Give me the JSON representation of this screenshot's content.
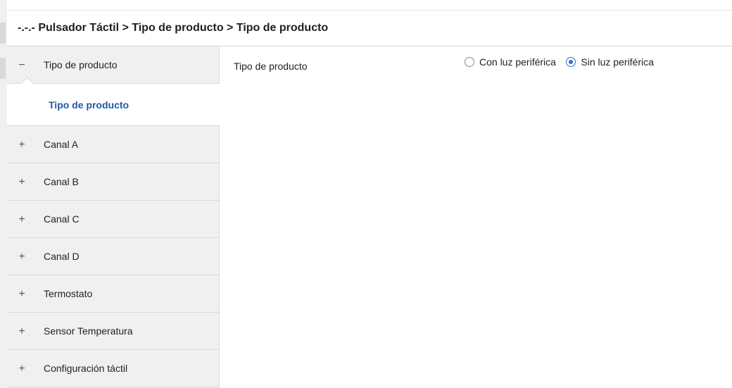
{
  "header": {
    "title": "-.-.- Pulsador Táctil > Tipo de producto > Tipo de producto"
  },
  "sidebar": {
    "items": [
      {
        "symbol": "−",
        "label": "Tipo de producto",
        "expanded": true,
        "subitem": "Tipo de producto"
      },
      {
        "symbol": "+",
        "label": "Canal A"
      },
      {
        "symbol": "+",
        "label": "Canal B"
      },
      {
        "symbol": "+",
        "label": "Canal C"
      },
      {
        "symbol": "+",
        "label": "Canal D"
      },
      {
        "symbol": "+",
        "label": "Termostato"
      },
      {
        "symbol": "+",
        "label": "Sensor Temperatura"
      },
      {
        "symbol": "+",
        "label": "Configuración táctil"
      }
    ]
  },
  "main": {
    "param_label": "Tipo de producto",
    "options": [
      {
        "label": "Con luz periférica",
        "checked": false
      },
      {
        "label": "Sin luz periférica",
        "checked": true
      }
    ]
  },
  "colors": {
    "accent": "#3b6fc4",
    "selected_text": "#1e5aa8",
    "sidebar_bg": "#f0f0f0"
  }
}
